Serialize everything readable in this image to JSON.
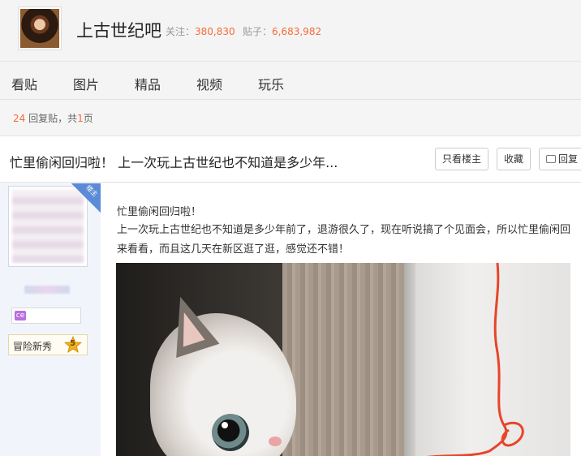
{
  "forum": {
    "name": "上古世纪吧",
    "follow_label": "关注：",
    "follow_count": "380,830",
    "posts_label": "贴子：",
    "posts_count": "6,683,982"
  },
  "nav": {
    "tabs": [
      "看贴",
      "图片",
      "精品",
      "视频",
      "玩乐"
    ]
  },
  "reply_info": {
    "count": "24",
    "text_mid": " 回复贴，共",
    "pages": "1",
    "text_end": "页"
  },
  "thread": {
    "title": "忙里偷闲回归啦！ 上一次玩上古世纪也不知道是多少年...",
    "buttons": {
      "only_owner": "只看楼主",
      "favorite": "收藏",
      "reply": "回复"
    }
  },
  "author": {
    "badge_icon_text": "ce",
    "level_title": "冒险新秀",
    "level_num": "5",
    "rank_corner_text": "楼主"
  },
  "post": {
    "line1": "忙里偷闲回归啦！",
    "paragraph": "上一次玩上古世纪也不知道是多少年前了，退游很久了，现在听说搞了个见面会，所以忙里偷闲回来看看，而且这几天在新区逛了逛，感觉还不错！",
    "image": "cat-peeking-photo"
  },
  "colors": {
    "accent_orange": "#f66b3a",
    "level_badge_border": "#e4d8a6",
    "author_bg": "#f1f5fb"
  }
}
